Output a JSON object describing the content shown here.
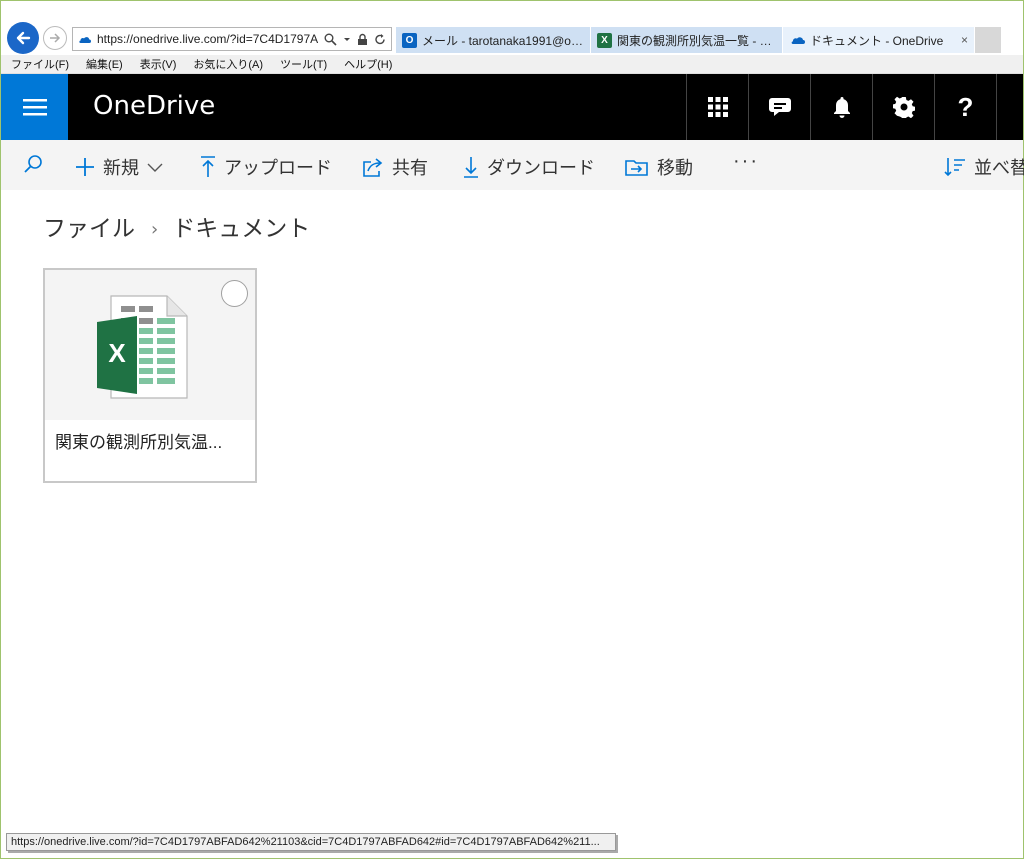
{
  "browser": {
    "url": "https://onedrive.live.com/?id=7C4D1797ABF.",
    "tabs": [
      {
        "label": "メール - tarotanaka1991@outloo...",
        "icon": "outlook-icon"
      },
      {
        "label": "関東の観測所別気温一覧 - Mic...",
        "icon": "excel-icon"
      },
      {
        "label": "ドキュメント - OneDrive",
        "icon": "onedrive-icon",
        "close": "×"
      }
    ],
    "menu": [
      "ファイル(F)",
      "編集(E)",
      "表示(V)",
      "お気に入り(A)",
      "ツール(T)",
      "ヘルプ(H)"
    ]
  },
  "suite": {
    "brand": "OneDrive",
    "accent": "#0078d7",
    "help_label": "?"
  },
  "commands": {
    "new": "新規",
    "upload": "アップロード",
    "share": "共有",
    "download": "ダウンロード",
    "move": "移動",
    "more": "···",
    "sort": "並べ替"
  },
  "breadcrumb": {
    "root": "ファイル",
    "separator": "›",
    "current": "ドキュメント"
  },
  "files": [
    {
      "name": "関東の観測所別気温...",
      "type": "excel",
      "badge": "X"
    }
  ],
  "status": {
    "text": "https://onedrive.live.com/?id=7C4D1797ABFAD642%21103&cid=7C4D1797ABFAD642#id=7C4D1797ABFAD642%211..."
  }
}
